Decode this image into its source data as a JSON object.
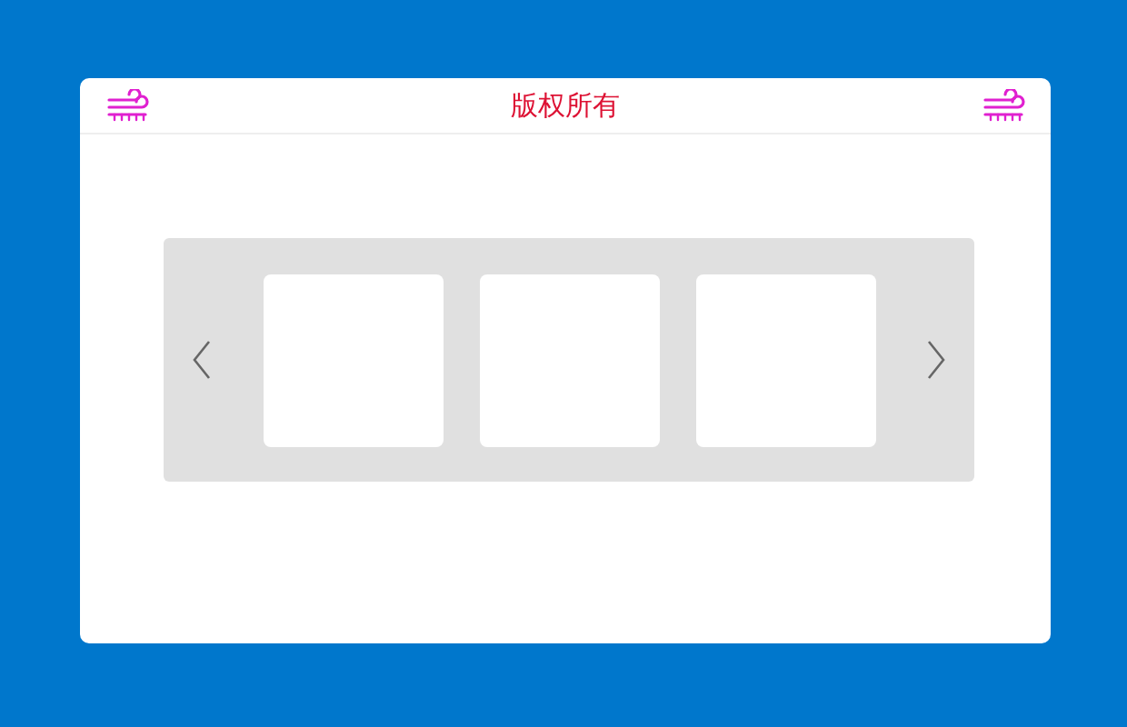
{
  "header": {
    "title": "版权所有"
  },
  "carousel": {
    "slides": [
      {
        "kind": "blank"
      },
      {
        "kind": "blank"
      },
      {
        "kind": "blank"
      }
    ]
  }
}
